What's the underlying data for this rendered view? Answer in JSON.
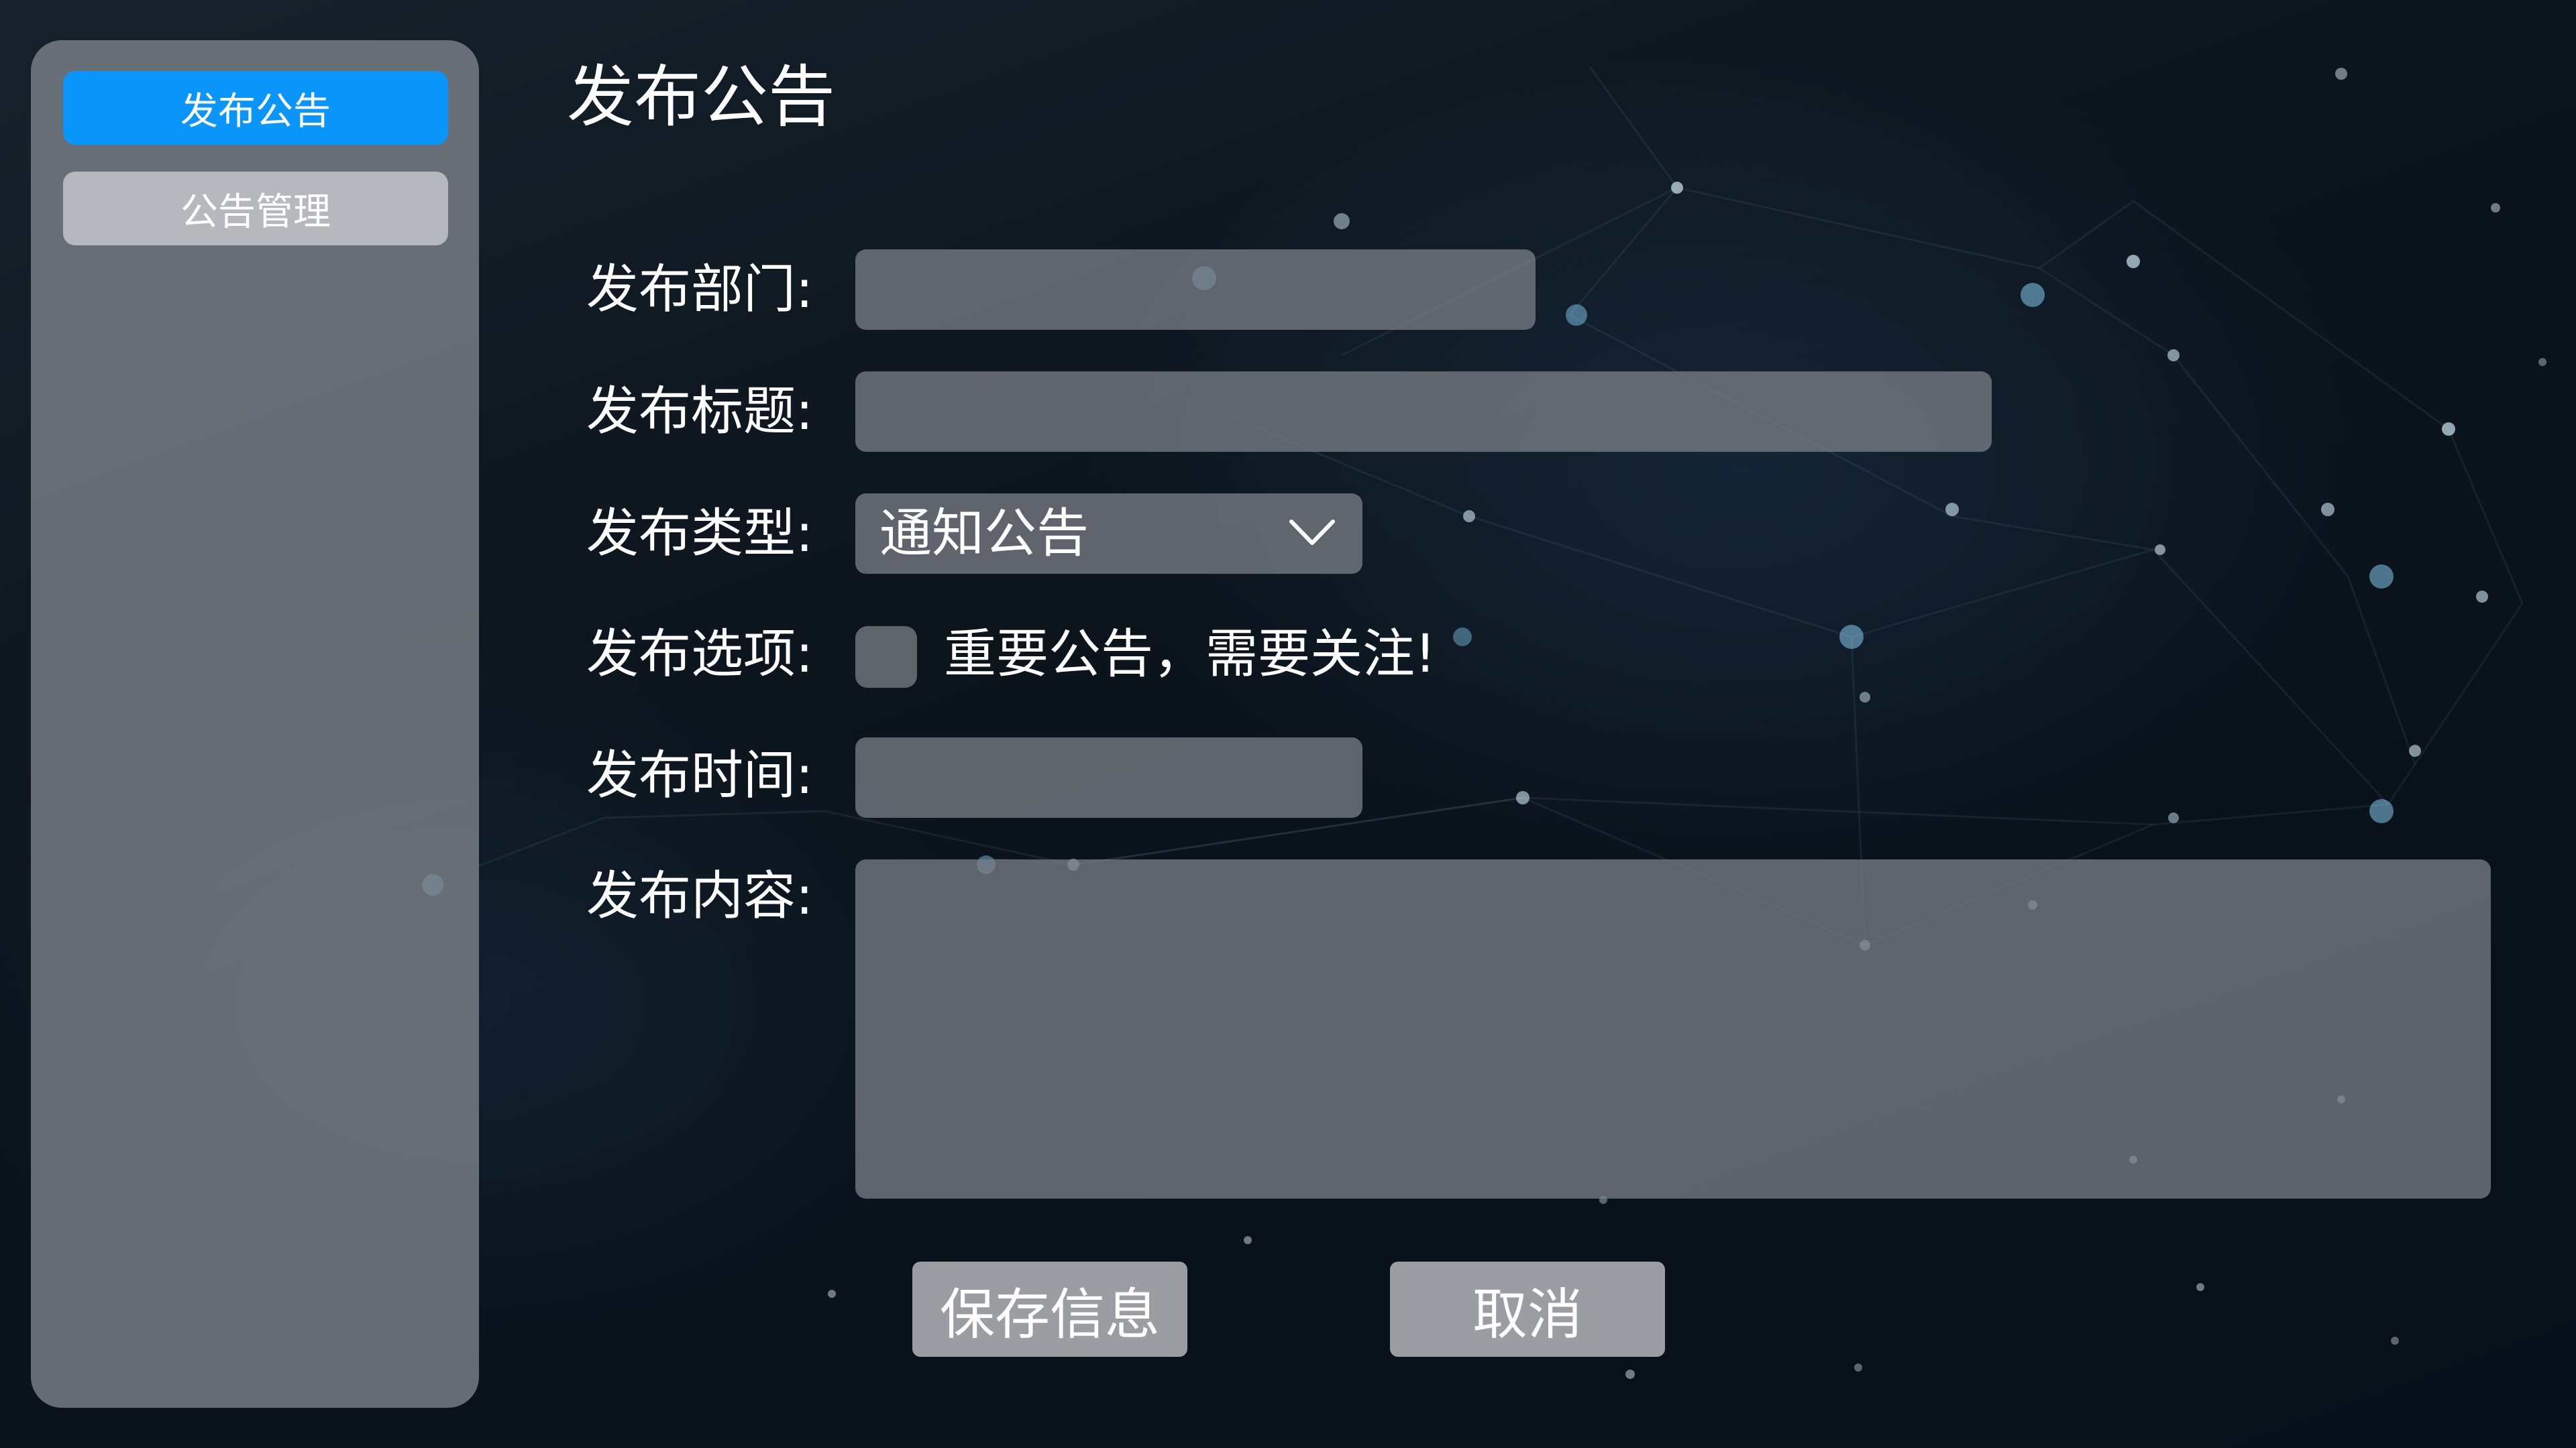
{
  "sidebar": {
    "items": [
      {
        "label": "发布公告",
        "active": true
      },
      {
        "label": "公告管理",
        "active": false
      }
    ]
  },
  "page": {
    "title": "发布公告"
  },
  "form": {
    "department": {
      "label": "发布部门:",
      "value": ""
    },
    "title": {
      "label": "发布标题:",
      "value": ""
    },
    "type": {
      "label": "发布类型:",
      "value": "通知公告",
      "icon": "chevron-down-icon"
    },
    "options": {
      "label": "发布选项:",
      "checkbox_label": "重要公告，需要关注!",
      "checked": false
    },
    "time": {
      "label": "发布时间:",
      "value": ""
    },
    "content": {
      "label": "发布内容:",
      "value": ""
    }
  },
  "actions": {
    "save_label": "保存信息",
    "cancel_label": "取消"
  },
  "colors": {
    "accent": "#0a95fb",
    "panel": "#80858c",
    "button": "#9a9da1"
  }
}
